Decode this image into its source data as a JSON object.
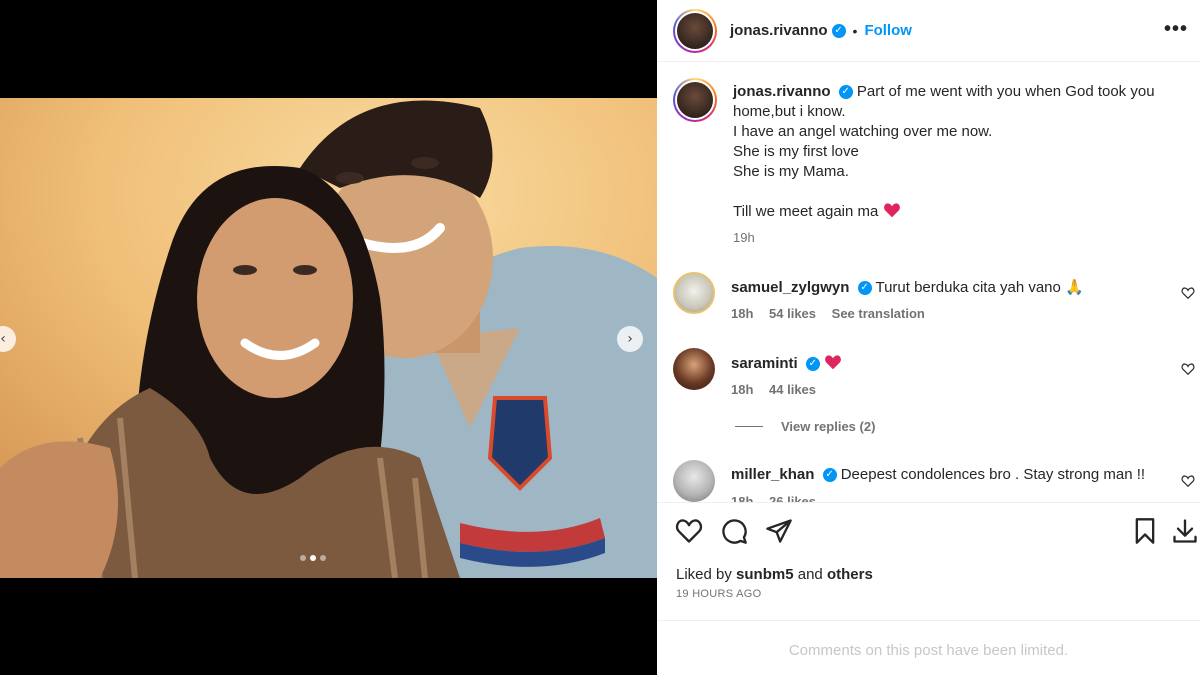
{
  "post": {
    "username": "jonas.rivanno",
    "separator": "•",
    "follow_label": "Follow",
    "more_label": "•••",
    "caption_lines": [
      "Part of me went with you when God took you home,but i know.",
      "I have an angel watching over me now.",
      "She is my first love",
      "She is my Mama.",
      "",
      "Till we meet again ma"
    ],
    "caption_time": "19h",
    "likes_prefix": "Liked by",
    "likes_user": "sunbm5",
    "likes_and": "and",
    "likes_others": "others",
    "posted_ago": "19 HOURS AGO",
    "limited_notice": "Comments on this post have been limited."
  },
  "carousel": {
    "slide_count": 3,
    "active_index": 1
  },
  "comments": [
    {
      "username": "samuel_zylgwyn",
      "text": "Turut berduka cita yah vano",
      "time": "18h",
      "likes": "54 likes",
      "extra": "See translation"
    },
    {
      "username": "saraminti",
      "text": "",
      "time": "18h",
      "likes": "44 likes",
      "extra": ""
    },
    {
      "username": "miller_khan",
      "text": "Deepest condolences bro . Stay strong man !!",
      "time": "18h",
      "likes": "26 likes",
      "extra": ""
    }
  ],
  "view_replies": "View replies (2)",
  "icons": [
    "heart-icon",
    "comment-icon",
    "share-icon",
    "save-icon",
    "download-icon",
    "verified-icon",
    "more-icon",
    "praying-hands-icon",
    "red-heart-icon"
  ],
  "colors": {
    "accent": "#0095f6",
    "red_heart": "#e0245e",
    "muted": "#737373"
  }
}
